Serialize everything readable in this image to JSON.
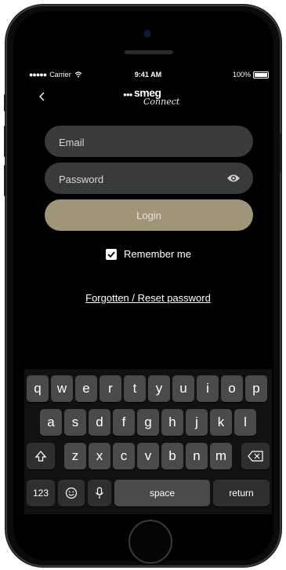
{
  "status_bar": {
    "carrier": "Carrier",
    "time": "9:41 AM",
    "battery": "100%"
  },
  "header": {
    "back": "back",
    "logo_brand": "smeg",
    "logo_sub": "Connect"
  },
  "form": {
    "email_placeholder": "Email",
    "password_placeholder": "Password",
    "login_label": "Login",
    "remember_label": "Remember me",
    "remember_checked": true,
    "forgot_label": "Forgotten / Reset password"
  },
  "keyboard": {
    "row1": [
      "q",
      "w",
      "e",
      "r",
      "t",
      "y",
      "u",
      "i",
      "o",
      "p"
    ],
    "row2": [
      "a",
      "s",
      "d",
      "f",
      "g",
      "h",
      "j",
      "k",
      "l"
    ],
    "row3": [
      "z",
      "x",
      "c",
      "v",
      "b",
      "n",
      "m"
    ],
    "numbers_label": "123",
    "space_label": "space",
    "return_label": "return"
  },
  "colors": {
    "login_button": "#a09479",
    "field_bg": "#3a3a3a",
    "background": "#000000"
  }
}
